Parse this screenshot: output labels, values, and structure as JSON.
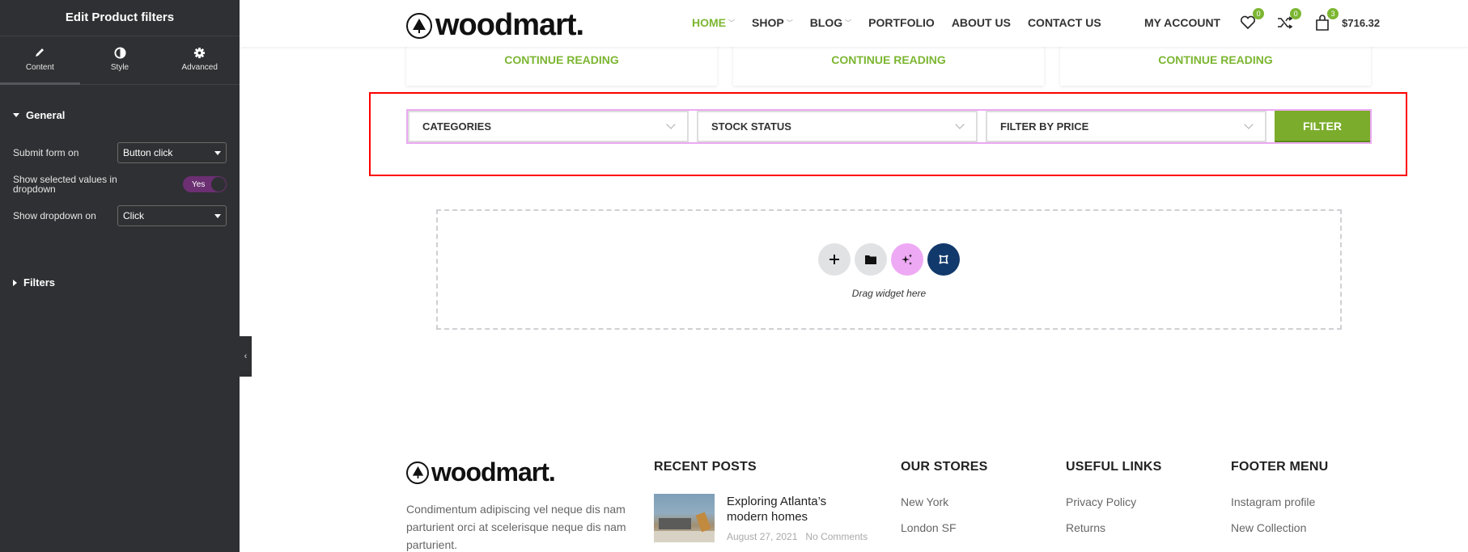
{
  "panel": {
    "title": "Edit Product filters",
    "tabs": [
      {
        "label": "Content",
        "icon": "pencil-icon",
        "active": true
      },
      {
        "label": "Style",
        "icon": "contrast-icon",
        "active": false
      },
      {
        "label": "Advanced",
        "icon": "gear-icon",
        "active": false
      }
    ],
    "general": {
      "heading": "General",
      "submit_label": "Submit form on",
      "submit_value": "Button click",
      "show_selected_label": "Show selected values in dropdown",
      "show_selected_toggle": "Yes",
      "show_dropdown_label": "Show dropdown on",
      "show_dropdown_value": "Click"
    },
    "filters": {
      "heading": "Filters"
    },
    "collapse_icon": "‹"
  },
  "header": {
    "logo_text": "woodmart.",
    "nav": [
      {
        "label": "HOME",
        "dropdown": true,
        "active": true
      },
      {
        "label": "SHOP",
        "dropdown": true,
        "active": false
      },
      {
        "label": "BLOG",
        "dropdown": true,
        "active": false
      },
      {
        "label": "PORTFOLIO",
        "dropdown": false,
        "active": false
      },
      {
        "label": "ABOUT US",
        "dropdown": false,
        "active": false
      },
      {
        "label": "CONTACT US",
        "dropdown": false,
        "active": false
      }
    ],
    "account_label": "MY ACCOUNT",
    "wishlist_count": "0",
    "compare_count": "0",
    "cart_count": "3",
    "cart_total": "$716.32"
  },
  "cards": [
    {
      "link": "CONTINUE READING"
    },
    {
      "link": "CONTINUE READING"
    },
    {
      "link": "CONTINUE READING"
    }
  ],
  "filters": {
    "selects": [
      "CATEGORIES",
      "STOCK STATUS",
      "FILTER BY PRICE"
    ],
    "button": "FILTER",
    "accent": "#7cac2c"
  },
  "dropzone": {
    "text": "Drag widget here",
    "buttons": [
      "add-icon",
      "folder-icon",
      "ai-sparkle-icon",
      "elementor-kit-icon"
    ]
  },
  "footer": {
    "logo_text": "woodmart.",
    "description": "Condimentum adipiscing vel neque dis nam parturient orci at scelerisque neque dis nam parturient.",
    "recent_posts": {
      "heading": "RECENT POSTS",
      "post_title": "Exploring Atlanta’s modern homes",
      "post_date": "August 27, 2021",
      "post_comments": "No Comments"
    },
    "stores": {
      "heading": "OUR STORES",
      "links": [
        "New York",
        "London SF"
      ]
    },
    "useful": {
      "heading": "USEFUL LINKS",
      "links": [
        "Privacy Policy",
        "Returns"
      ]
    },
    "menu": {
      "heading": "FOOTER MENU",
      "links": [
        "Instagram profile",
        "New Collection"
      ]
    }
  }
}
